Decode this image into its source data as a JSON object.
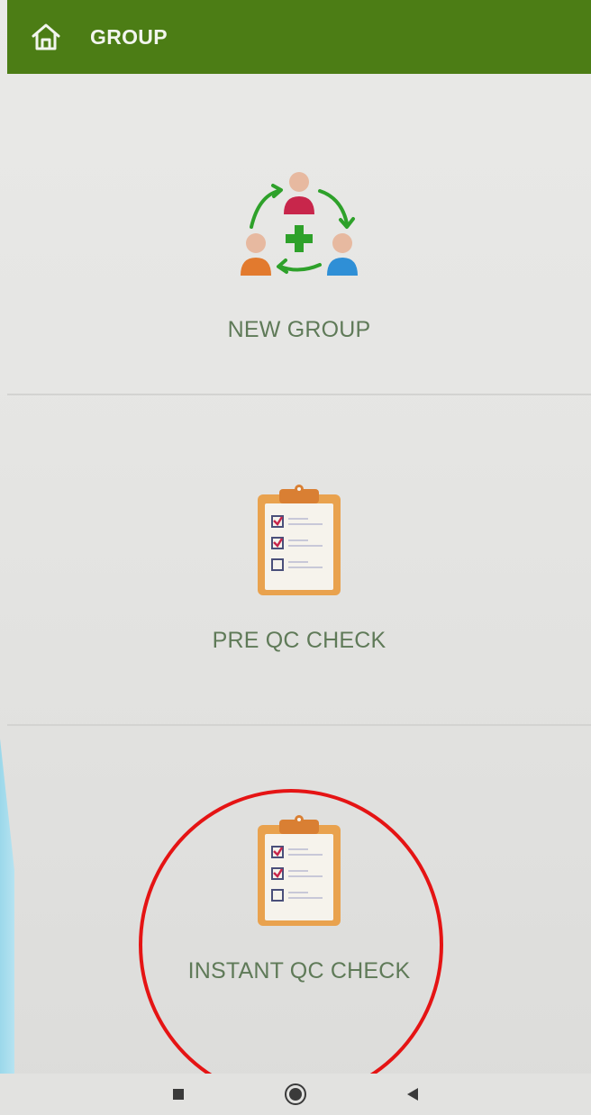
{
  "header": {
    "title": "GROUP",
    "home_icon": "home-icon",
    "background": "#4c7d15"
  },
  "menu": {
    "items": [
      {
        "label": "NEW GROUP",
        "icon": "group-add-icon"
      },
      {
        "label": "PRE QC CHECK",
        "icon": "clipboard-checklist-icon"
      },
      {
        "label": "INSTANT QC CHECK",
        "icon": "clipboard-checklist-icon"
      }
    ]
  },
  "nav": {
    "recent_icon": "square-recents-icon",
    "home_icon": "circle-home-icon",
    "back_icon": "triangle-back-icon"
  },
  "colors": {
    "label": "#5f7a58",
    "annotation": "#e51414"
  }
}
